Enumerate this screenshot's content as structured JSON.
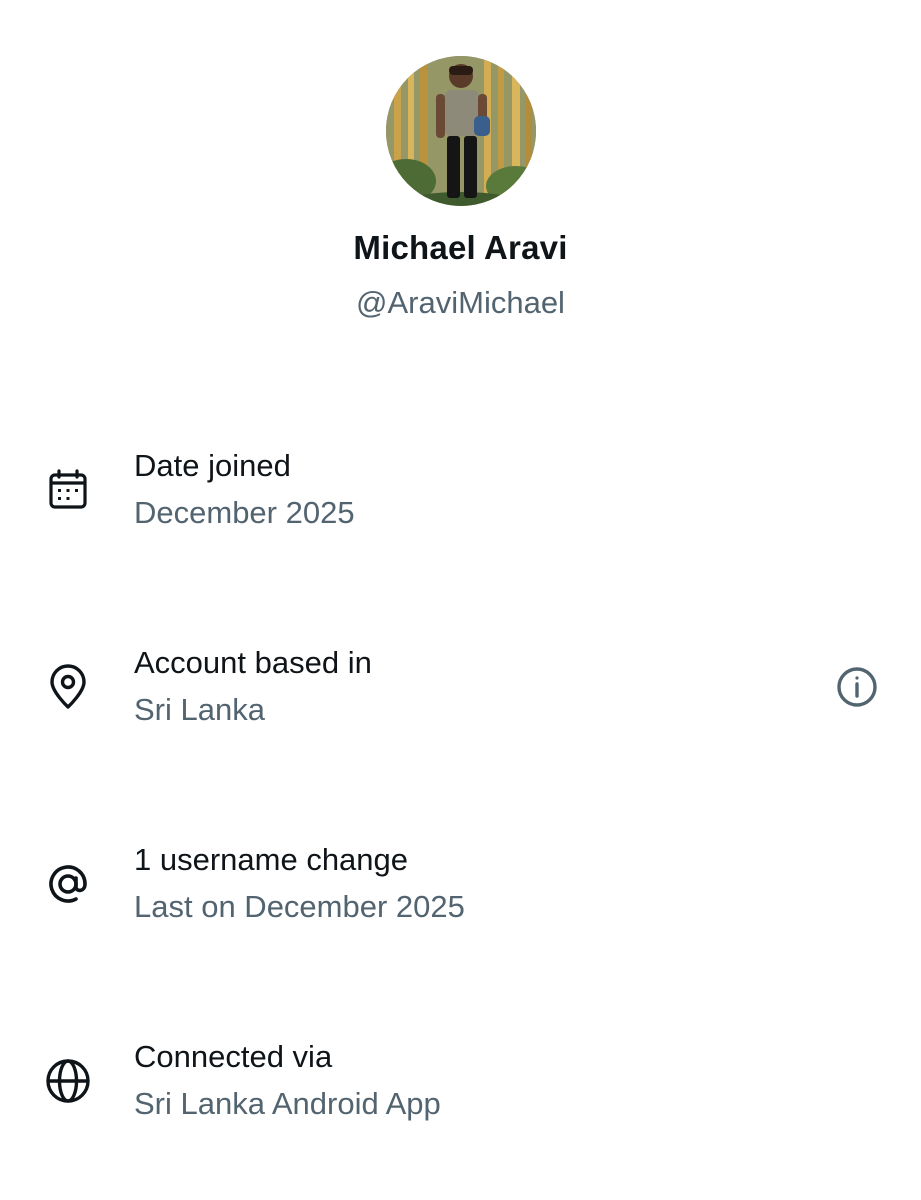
{
  "profile": {
    "name": "Michael Aravi",
    "handle": "@AraviMichael"
  },
  "details": [
    {
      "icon": "calendar-icon",
      "title": "Date joined",
      "value": "December 2025"
    },
    {
      "icon": "location-pin-icon",
      "title": "Account based in",
      "value": "Sri Lanka",
      "trailing_icon": "info-icon"
    },
    {
      "icon": "at-sign-icon",
      "title": "1 username change",
      "value": "Last on December 2025"
    },
    {
      "icon": "globe-icon",
      "title": "Connected via",
      "value": "Sri Lanka Android App"
    }
  ],
  "colors": {
    "primary_text": "#0f1419",
    "secondary_text": "#536471"
  }
}
